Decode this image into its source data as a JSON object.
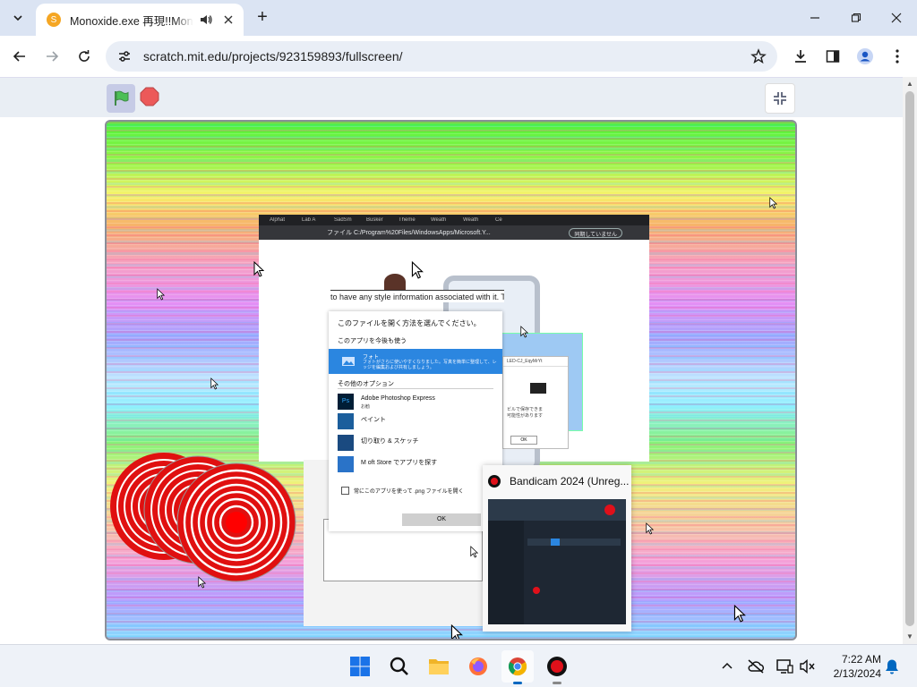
{
  "browser": {
    "tab": {
      "title": "Monoxide.exe 再現!!Monoxide",
      "favicon": "scratch-favicon"
    },
    "new_tab_label": "+",
    "url": "scratch.mit.edu/projects/923159893/fullscreen/"
  },
  "colors": {
    "tabstrip": "#dbe4f3",
    "omnibox": "#e9eef6",
    "scratch_bar": "#e9eef4",
    "green_flag": "#4cbf56",
    "stop": "#ec5959",
    "taskbar": "#eef2f8"
  },
  "stage": {
    "inner_browser": {
      "tabs": [
        "Alphat",
        "Lab A",
        "SadSm",
        "Busker",
        "Theme",
        "Weath",
        "Weath",
        "Ce"
      ],
      "url": "ファイル  C:/Program%20Files/WindowsApps/Microsoft.Y...",
      "signin": "同期していません"
    },
    "xml_text": "to have any style information associated with it. T",
    "open_with": {
      "title": "このファイルを開く方法を選んでください。",
      "keep_using": "このアプリを今後も使う",
      "selected_app": "フォト",
      "selected_desc": "フォトがさらに使いやすくなりました。写真を簡単に整理して、レッジを編集および共有しましょう。",
      "other_options": "その他のオプション",
      "apps": [
        {
          "name": "Adobe Photoshop Express",
          "sub": "お勧",
          "icon": "photoshop-icon"
        },
        {
          "name": "ペイント",
          "sub": "",
          "icon": "paint-icon"
        },
        {
          "name": "切り取り & スケッチ",
          "sub": "",
          "icon": "snip-icon"
        },
        {
          "name": "M      oft Store でアプリを探す",
          "sub": "",
          "icon": "store-icon"
        }
      ],
      "always_use": "常にこのアプリを使って .png ファイルを開く",
      "ok": "OK"
    },
    "mini_dialog": {
      "title": "LED-CJ_EqyMrYt",
      "lines": [
        "ビルで保存できま",
        "可能性があります"
      ],
      "ok": "OK"
    },
    "bandicam": {
      "title": "Bandicam 2024 (Unreg..."
    }
  },
  "taskbar": {
    "apps": [
      "start-icon",
      "search-icon",
      "file-explorer-icon",
      "firefox-icon",
      "chrome-icon",
      "bandicam-icon"
    ],
    "time": "7:22 AM",
    "date": "2/13/2024"
  }
}
